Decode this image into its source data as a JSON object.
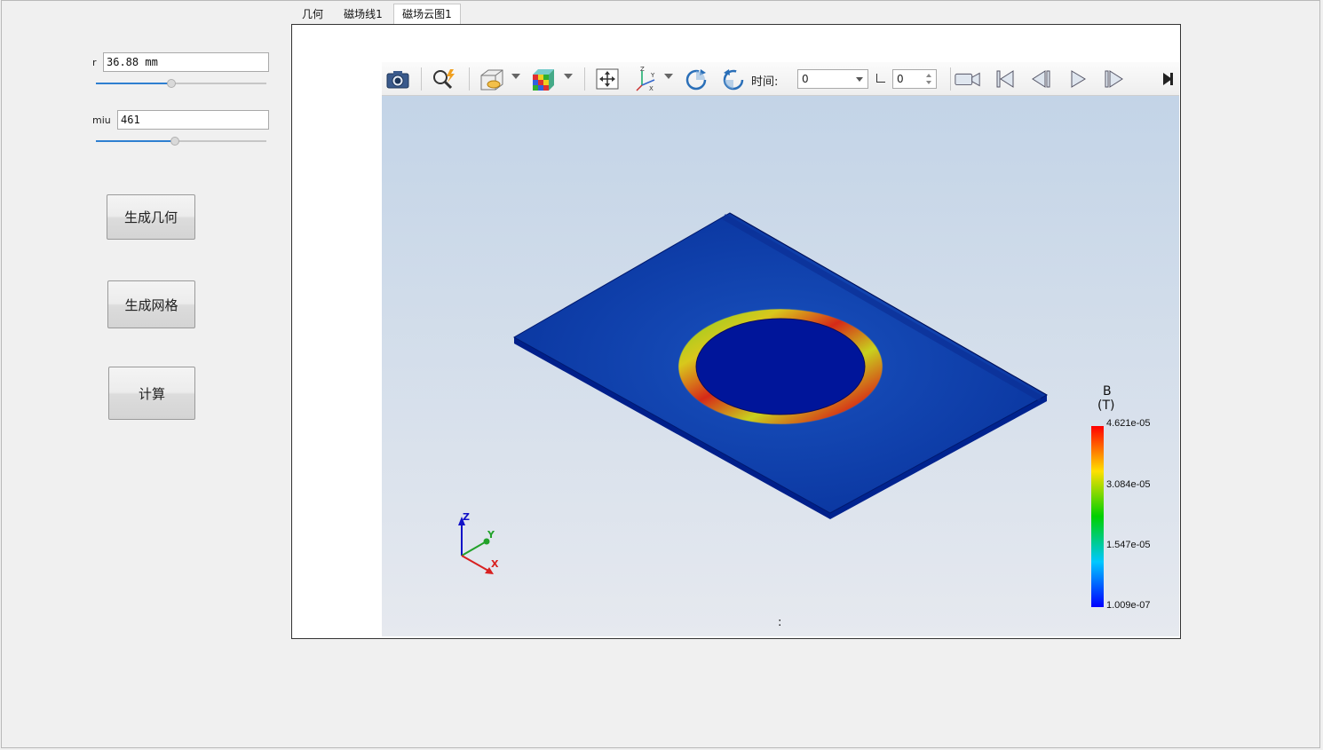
{
  "params": {
    "r": {
      "label": "r",
      "value": "36.88 mm",
      "slider_fraction": 0.46
    },
    "miu": {
      "label": "miu",
      "value": "461",
      "slider_fraction": 0.46
    }
  },
  "buttons": {
    "generate_geometry": "生成几何",
    "generate_mesh": "生成网格",
    "compute": "计算"
  },
  "tabs": [
    {
      "label": "几何",
      "active": false
    },
    {
      "label": "磁场线1",
      "active": false
    },
    {
      "label": "磁场云图1",
      "active": true
    }
  ],
  "viewer": {
    "toolbar": {
      "icons": [
        "camera-icon",
        "zoom-fit-icon",
        "display-mode-icon",
        "colormap-cube-icon",
        "move-center-icon",
        "axis-view-icon",
        "rotate-cw-icon",
        "rotate-ccw-icon",
        "video-record-icon",
        "first-frame-icon",
        "prev-frame-icon",
        "play-icon",
        "next-frame-icon",
        "expand-icon"
      ],
      "time_label": "时间:",
      "time_value": "0",
      "step_value": "0"
    },
    "legend": {
      "title_line1": "B",
      "title_line2": "(T)",
      "ticks": [
        "4.621e-05",
        "3.084e-05",
        "1.547e-05",
        "1.009e-07"
      ]
    },
    "triad": {
      "x": "X",
      "y": "Y",
      "z": "Z"
    },
    "status_text": ":",
    "colors": {
      "plate": "#0a3aa8",
      "plate_edge": "#001f8a",
      "ring_hot": "#d81b1b",
      "ring_mid": "#7fcf22",
      "ring_warm": "#d9d21e",
      "bg_top": "#c3d4e7",
      "bg_bottom": "#e6e9ef"
    }
  }
}
